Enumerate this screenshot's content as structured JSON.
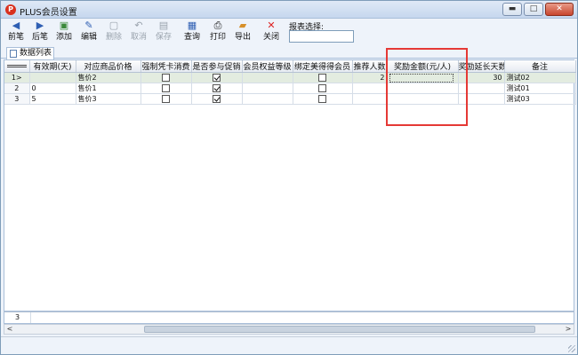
{
  "window": {
    "title": "PLUS会员设置",
    "app_icon": "P",
    "minimize": "▬",
    "maximize": "□",
    "close": "✕"
  },
  "toolbar": {
    "buttons": [
      {
        "label": "前笔",
        "icon": "arrow-left-icon",
        "glyph": "◀",
        "enabled": true
      },
      {
        "label": "后笔",
        "icon": "arrow-right-icon",
        "glyph": "▶",
        "enabled": true
      },
      {
        "label": "添加",
        "icon": "add-doc-icon",
        "glyph": "▣",
        "enabled": true
      },
      {
        "label": "编辑",
        "icon": "edit-icon",
        "glyph": "✎",
        "enabled": true
      },
      {
        "label": "删除",
        "icon": "delete-doc-icon",
        "glyph": "▢",
        "enabled": false
      },
      {
        "label": "取消",
        "icon": "undo-icon",
        "glyph": "↶",
        "enabled": false
      },
      {
        "label": "保存",
        "icon": "save-icon",
        "glyph": "▤",
        "enabled": false
      },
      {
        "label": "查询",
        "icon": "query-icon",
        "glyph": "▦",
        "enabled": true
      },
      {
        "label": "打印",
        "icon": "printer-icon",
        "glyph": "⎙",
        "enabled": true
      },
      {
        "label": "导出",
        "icon": "export-folder-icon",
        "glyph": "▰",
        "enabled": true
      },
      {
        "label": "关闭",
        "icon": "close-red-icon",
        "glyph": "✕",
        "enabled": true
      }
    ],
    "report_label": "报表选择:",
    "report_value": ""
  },
  "tab": {
    "label": "数据列表"
  },
  "grid": {
    "columns": [
      "",
      "有效期(天)",
      "对应商品价格",
      "强制凭卡消费",
      "是否参与促销",
      "会员权益等级",
      "绑定美得得会员",
      "推荐人数",
      "奖励金额(元/人)",
      "奖励延长天数",
      "备注"
    ],
    "rows": [
      {
        "rownum": "1>",
        "validity": "",
        "price": "售价2",
        "forced_card": false,
        "promo": true,
        "level": "",
        "bind": false,
        "referrals": "2",
        "reward": "",
        "extend_days": "30",
        "note": "测试02"
      },
      {
        "rownum": "2",
        "validity": "0",
        "price": "售价1",
        "forced_card": false,
        "promo": true,
        "level": "",
        "bind": false,
        "referrals": "",
        "reward": "",
        "extend_days": "",
        "note": "测试01"
      },
      {
        "rownum": "3",
        "validity": "5",
        "price": "售价3",
        "forced_card": false,
        "promo": true,
        "level": "",
        "bind": false,
        "referrals": "",
        "reward": "",
        "extend_days": "",
        "note": "测试03"
      }
    ],
    "footer_count": "3"
  },
  "scrollbar": {
    "left": "<",
    "right": ">"
  },
  "colors": {
    "highlight": "#e53935",
    "selected_row": "#e3ece0",
    "title_bg": "#dfe9f6"
  }
}
